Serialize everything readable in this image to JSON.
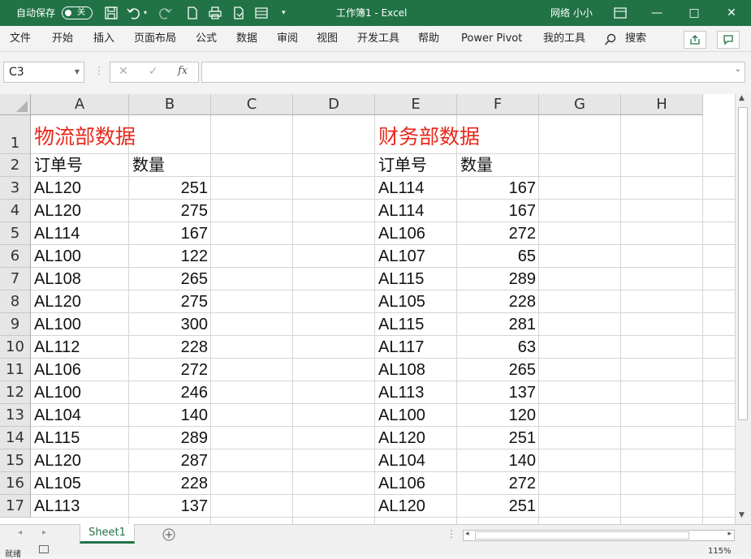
{
  "titlebar": {
    "autosave_label": "自动保存",
    "autosave_state": "关",
    "doc_title": "工作簿1  -  Excel",
    "user": "网络 小小"
  },
  "menu": [
    "文件",
    "开始",
    "插入",
    "页面布局",
    "公式",
    "数据",
    "审阅",
    "视图",
    "开发工具",
    "帮助",
    "Power Pivot",
    "我的工具"
  ],
  "search_label": "搜索",
  "formula": {
    "name_box": "C3",
    "fx": "fx",
    "cancel": "✕",
    "confirm": "✓",
    "content": ""
  },
  "columns": [
    "A",
    "B",
    "C",
    "D",
    "E",
    "F",
    "G",
    "H"
  ],
  "rows": [
    "1",
    "2",
    "3",
    "4",
    "5",
    "6",
    "7",
    "8",
    "9",
    "10",
    "11",
    "12",
    "13",
    "14",
    "15",
    "16",
    "17"
  ],
  "table_left": {
    "title": "物流部数据",
    "headers": [
      "订单号",
      "数量"
    ],
    "data": [
      [
        "AL120",
        "251"
      ],
      [
        "AL120",
        "275"
      ],
      [
        "AL114",
        "167"
      ],
      [
        "AL100",
        "122"
      ],
      [
        "AL108",
        "265"
      ],
      [
        "AL120",
        "275"
      ],
      [
        "AL100",
        "300"
      ],
      [
        "AL112",
        "228"
      ],
      [
        "AL106",
        "272"
      ],
      [
        "AL100",
        "246"
      ],
      [
        "AL104",
        "140"
      ],
      [
        "AL115",
        "289"
      ],
      [
        "AL120",
        "287"
      ],
      [
        "AL105",
        "228"
      ],
      [
        "AL113",
        "137"
      ]
    ]
  },
  "table_right": {
    "title": "财务部数据",
    "headers": [
      "订单号",
      "数量"
    ],
    "data": [
      [
        "AL114",
        "167"
      ],
      [
        "AL114",
        "167"
      ],
      [
        "AL106",
        "272"
      ],
      [
        "AL107",
        "65"
      ],
      [
        "AL115",
        "289"
      ],
      [
        "AL105",
        "228"
      ],
      [
        "AL115",
        "281"
      ],
      [
        "AL117",
        "63"
      ],
      [
        "AL108",
        "265"
      ],
      [
        "AL113",
        "137"
      ],
      [
        "AL100",
        "120"
      ],
      [
        "AL120",
        "251"
      ],
      [
        "AL104",
        "140"
      ],
      [
        "AL106",
        "272"
      ],
      [
        "AL120",
        "251"
      ]
    ]
  },
  "sheet": {
    "tab": "Sheet1"
  },
  "status": {
    "ready": "就绪",
    "zoom": "115%"
  },
  "colors": {
    "accent": "#217346",
    "title_red": "#e8281c"
  }
}
